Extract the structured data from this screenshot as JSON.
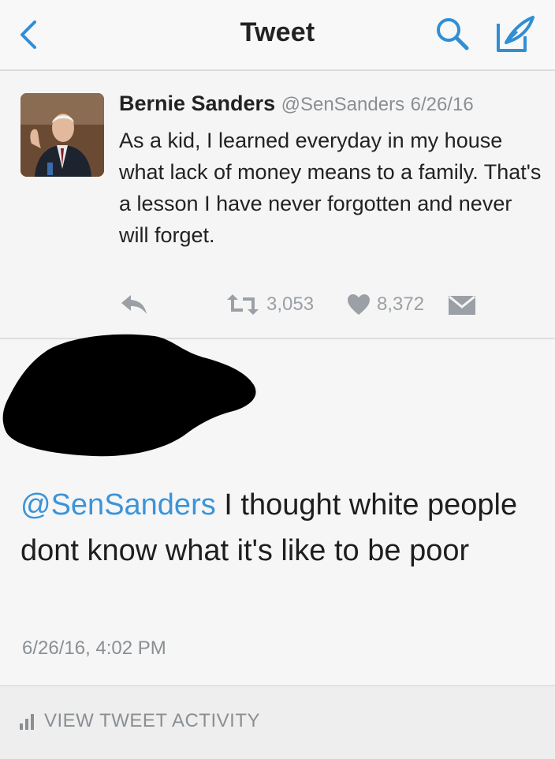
{
  "nav": {
    "back_icon": "chevron-left-icon",
    "title": "Tweet",
    "search_icon": "search-icon",
    "compose_icon": "compose-icon"
  },
  "quoted_tweet": {
    "name": "Bernie Sanders",
    "handle": "@SenSanders",
    "date": "6/26/16",
    "text": "As a kid, I learned everyday in my house what lack of money means to a family. That's a lesson I have never forgotten and never will forget.",
    "retweets": "3,053",
    "likes": "8,372"
  },
  "reply": {
    "mention": "@SenSanders",
    "text": "I thought white people dont know what it's like to be poor",
    "timestamp": "6/26/16, 4:02 PM"
  },
  "activity": {
    "label": "VIEW TWEET ACTIVITY"
  },
  "colors": {
    "accent": "#3b94d9",
    "muted": "#8a8f94",
    "redaction": "#000000"
  }
}
